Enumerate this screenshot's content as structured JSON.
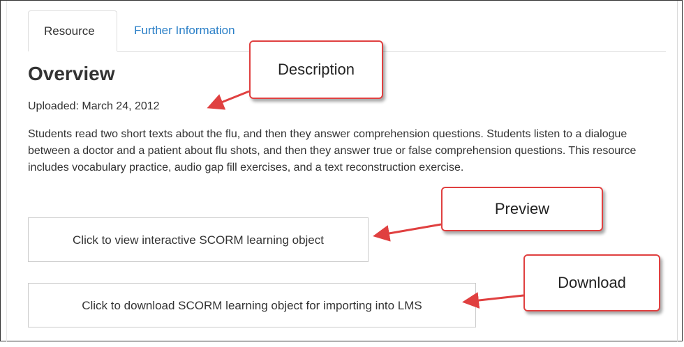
{
  "tabs": [
    {
      "label": "Resource",
      "active": true
    },
    {
      "label": "Further Information",
      "active": false
    }
  ],
  "overview": {
    "title": "Overview",
    "uploaded": "Uploaded: March 24, 2012",
    "description": "Students read two short texts about the flu, and then they answer comprehension questions. Students listen to a dialogue between a doctor and a patient about flu shots, and then they answer true or false comprehension questions. This resource includes vocabulary practice, audio gap fill exercises, and a text reconstruction exercise."
  },
  "buttons": {
    "view_label": "Click to view interactive SCORM learning object",
    "download_label": "Click to download SCORM learning object for importing into LMS"
  },
  "callouts": {
    "description": "Description",
    "preview": "Preview",
    "download": "Download"
  },
  "colors": {
    "tab_link": "#2a7fc7",
    "callout_border": "#e04040",
    "arrow": "#e04040"
  }
}
